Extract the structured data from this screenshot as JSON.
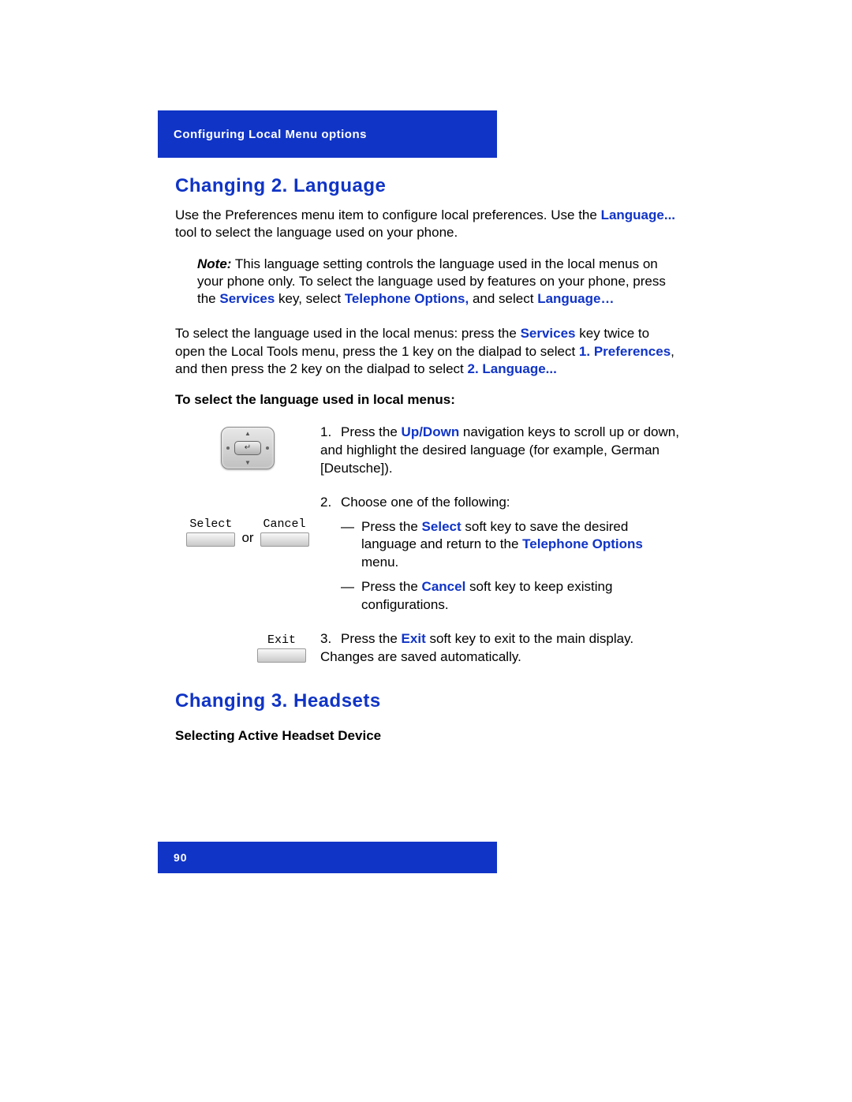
{
  "header": {
    "title": "Configuring Local Menu options"
  },
  "section1": {
    "heading": "Changing 2. Language",
    "intro_p1a": "Use the Preferences menu item to configure local preferences. Use the ",
    "intro_link": "Language...",
    "intro_p1b": " tool to select the language used on your phone.",
    "note_label": "Note:",
    "note_p1": " This language setting controls the language used in the local menus on your phone only. To select the language used by features on your phone, press the ",
    "note_services": "Services",
    "note_p2": " key, select ",
    "note_telopt": "Telephone Options,",
    "note_p3": " and select ",
    "note_lang": "Language…",
    "para2_a": "To select the language used in the local menus: press the ",
    "para2_services": "Services",
    "para2_b": " key twice to open the Local Tools menu, press the 1 key on the dialpad to select ",
    "para2_prefs": "1. Preferences",
    "para2_c": ", and then press the 2 key on the dialpad to select ",
    "para2_lang": "2. Language...",
    "subheading": "To select the language used in local menus:",
    "step1_text_a": "Press the ",
    "step1_updown": "Up/Down",
    "step1_text_b": " navigation keys to scroll up or down, and highlight the desired language (for example, German [Deutsche]).",
    "step2_text": "Choose one of the following:",
    "step2a_a": "Press the ",
    "step2a_select": "Select",
    "step2a_b": " soft key to save the desired language and return to the ",
    "step2a_telopt": "Telephone Options",
    "step2a_c": " menu.",
    "step2b_a": "Press the ",
    "step2b_cancel": "Cancel",
    "step2b_b": " soft key to keep existing configurations.",
    "step3_a": "Press the ",
    "step3_exit": "Exit",
    "step3_b": " soft key to exit to the main display. Changes are saved automatically.",
    "softkey_select": "Select",
    "softkey_cancel": "Cancel",
    "softkey_exit": "Exit",
    "or_label": "or"
  },
  "section2": {
    "heading": "Changing 3. Headsets",
    "subheading": "Selecting Active Headset Device"
  },
  "footer": {
    "page": "90"
  }
}
